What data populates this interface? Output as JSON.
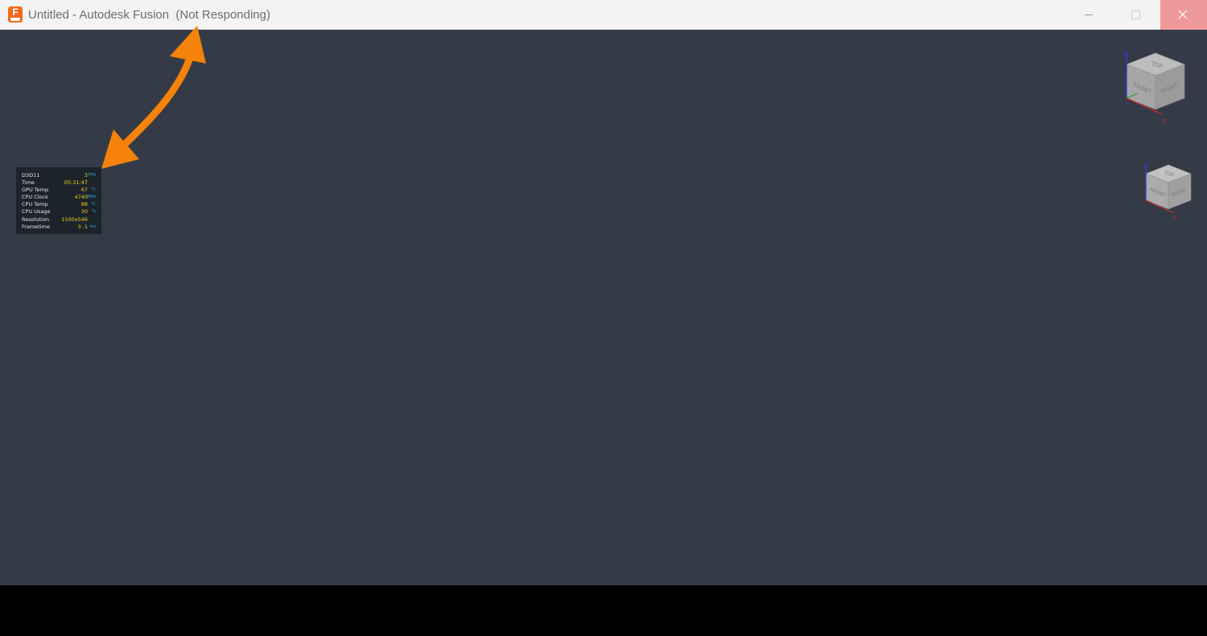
{
  "window": {
    "title": "Untitled - Autodesk Fusion  (Not Responding)",
    "app_icon": "fusion-app-icon",
    "app_icon_letter": "F",
    "accent_color": "#f26a1b"
  },
  "osd": {
    "rows": [
      {
        "label": "D3D11",
        "value": "3",
        "unit": "FPS"
      },
      {
        "label": "Time",
        "value": "05:31:47",
        "unit": ""
      },
      {
        "label": "GPU Temp",
        "value": "67",
        "unit": "°C"
      },
      {
        "label": "CPU Clock",
        "value": "4740",
        "unit": "MHz"
      },
      {
        "label": "CPU Temp",
        "value": "88",
        "unit": "°C"
      },
      {
        "label": "CPU Usage",
        "value": "30",
        "unit": "%"
      },
      {
        "label": "Resolution",
        "value": "1500x546",
        "unit": ""
      },
      {
        "label": "Frametime",
        "value": "3 .1",
        "unit": "ms"
      }
    ],
    "value_color": "#f2d21a",
    "unit_color": "#1fb2e8"
  },
  "viewcube": {
    "faces": {
      "top": "TOP",
      "front": "FRONT",
      "right": "RIGHT"
    },
    "axes": {
      "x": "X",
      "z": "Z"
    }
  },
  "annotation": {
    "type": "double-arrow",
    "color": "#f5820a"
  }
}
